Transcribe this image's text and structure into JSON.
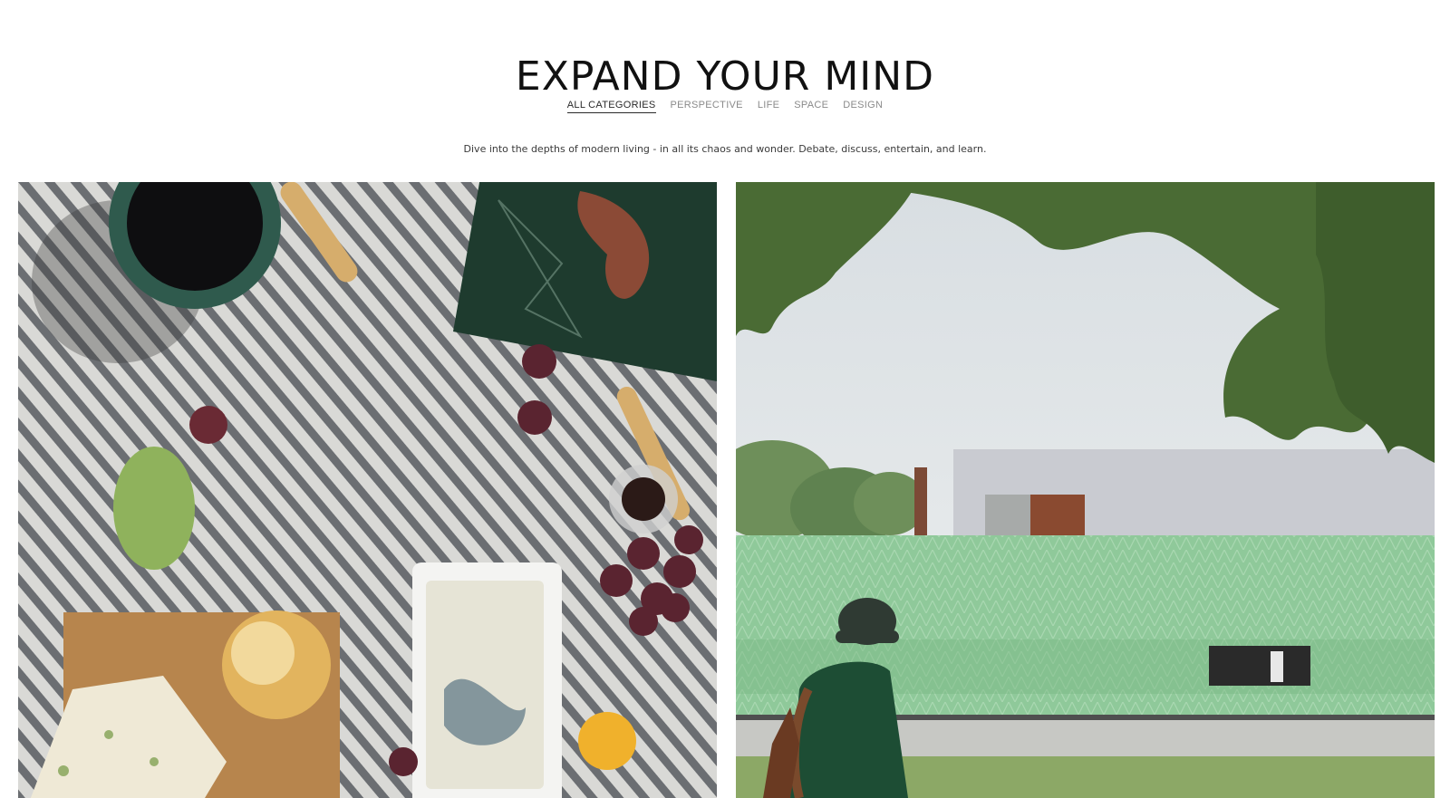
{
  "header": {
    "title": "EXPAND YOUR MIND",
    "categories": [
      {
        "label": "ALL CATEGORIES",
        "active": true
      },
      {
        "label": "PERSPECTIVE",
        "active": false
      },
      {
        "label": "LIFE",
        "active": false
      },
      {
        "label": "SPACE",
        "active": false
      },
      {
        "label": "DESIGN",
        "active": false
      }
    ],
    "tagline": "Dive into the depths of modern living - in all its chaos and wonder. Debate, discuss, entertain, and learn."
  },
  "articles": [
    {
      "image_icon": "picnic-food-image"
    },
    {
      "image_icon": "green-building-rider-image"
    }
  ],
  "colors": {
    "active_category": "#2a2a2a",
    "inactive_category": "#8a8a8a"
  }
}
